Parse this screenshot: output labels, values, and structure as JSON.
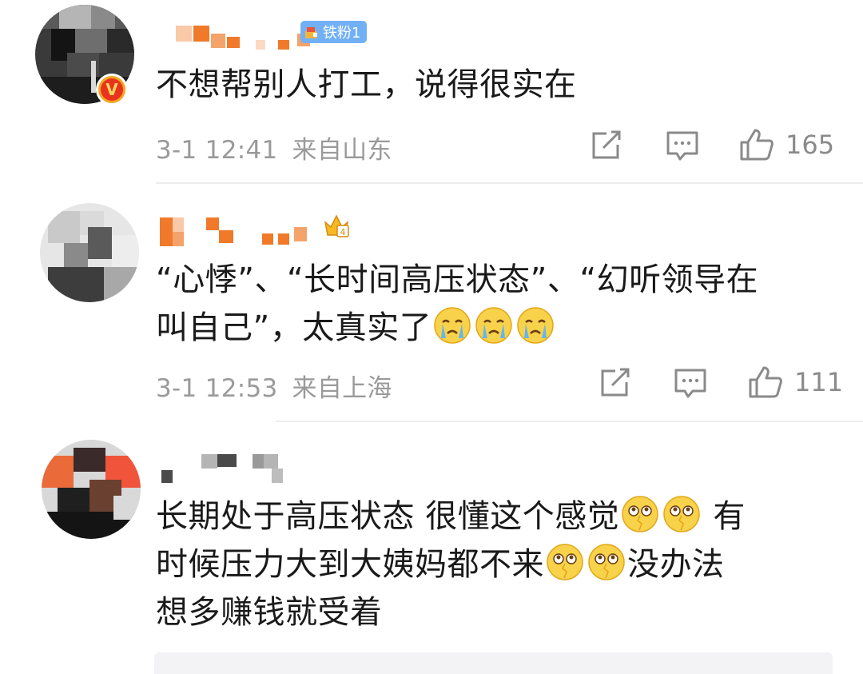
{
  "comments": [
    {
      "fan_badge": "铁粉1",
      "text": "不想帮别人打工，说得很实在",
      "time": "3-1 12:41",
      "location": "来自山东",
      "likes": "165",
      "avatar_icon": "user-avatar-pixelated",
      "verified": true
    },
    {
      "text_line1": "“心悸”、“长时间高压状态”、“幻听领导在",
      "text_line2": "叫自己”，太真实了",
      "emojis": [
        "crying-emoji",
        "crying-emoji",
        "crying-emoji"
      ],
      "time": "3-1 12:53",
      "location": "来自上海",
      "likes": "111",
      "avatar_icon": "user-avatar-pixelated",
      "level_icon": "crown-level-4-icon"
    },
    {
      "text_line1a": "长期处于高压状态  很懂这个感觉",
      "text_line1b": " 有",
      "text_line2a": "时候压力大到大姨妈都不来",
      "text_line2b": "没办法",
      "text_line3": "想多赚钱就受着",
      "emojis": [
        "broken-heart-eyes-emoji"
      ],
      "avatar_icon": "user-avatar-pixelated"
    }
  ],
  "icons": {
    "share": "share-icon",
    "comment": "comment-icon",
    "like": "thumbs-up-icon"
  },
  "colors": {
    "mosaic_orange": "#f07a2a",
    "fan_badge_blue": "#72b0f5",
    "meta_gray": "#9a9a9a",
    "verified_red": "#e8341c"
  }
}
